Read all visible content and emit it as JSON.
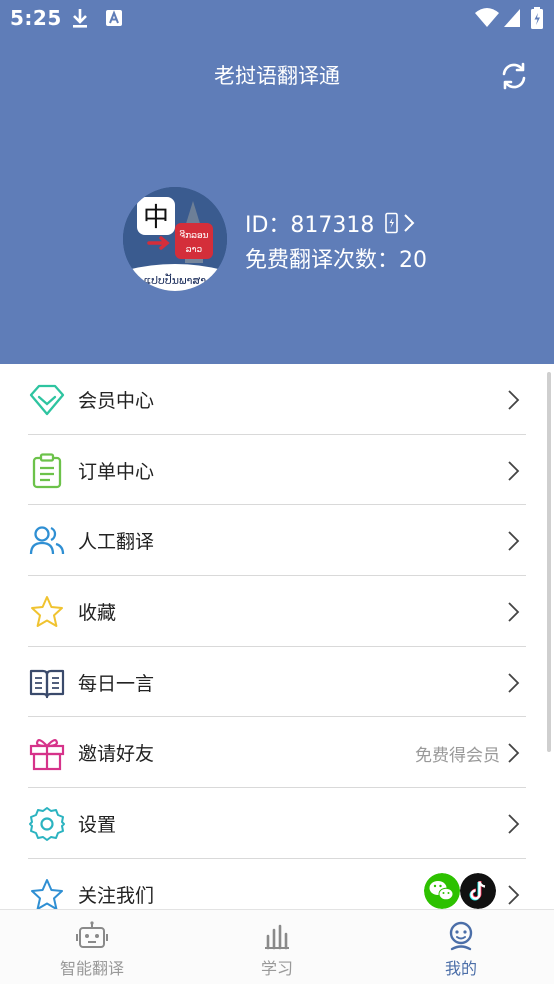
{
  "status_bar": {
    "time": "5:25"
  },
  "header": {
    "title": "老挝语翻译通"
  },
  "user": {
    "id_text": "ID：817318",
    "quota_text": "免费翻译次数：20",
    "avatar_char": "中",
    "avatar_badge_top": "ຈີກລອນ",
    "avatar_badge_bottom": "ລາວ",
    "avatar_caption": "ແປບປັນພາສາ"
  },
  "menu": {
    "items": [
      {
        "label": "会员中心",
        "icon": "diamond-icon",
        "color": "#2ec4a0"
      },
      {
        "label": "订单中心",
        "icon": "clipboard-icon",
        "color": "#6cc24a"
      },
      {
        "label": "人工翻译",
        "icon": "users-icon",
        "color": "#2f8fd3"
      },
      {
        "label": "收藏",
        "icon": "star-icon",
        "color": "#f0c330"
      },
      {
        "label": "每日一言",
        "icon": "book-icon",
        "color": "#3a4a6b"
      },
      {
        "label": "邀请好友",
        "icon": "gift-icon",
        "color": "#d6338a",
        "hint": "免费得会员"
      },
      {
        "label": "设置",
        "icon": "gear-icon",
        "color": "#2bb3c0"
      },
      {
        "label": "关注我们",
        "icon": "star-outline-icon",
        "color": "#2f8fd3"
      }
    ]
  },
  "tabbar": {
    "tabs": [
      {
        "label": "智能翻译",
        "icon": "robot-icon",
        "active": false
      },
      {
        "label": "学习",
        "icon": "chart-icon",
        "active": false
      },
      {
        "label": "我的",
        "icon": "profile-icon",
        "active": true
      }
    ]
  },
  "colors": {
    "header_bg": "#5f7db8",
    "active_tab": "#4b6ea8"
  }
}
